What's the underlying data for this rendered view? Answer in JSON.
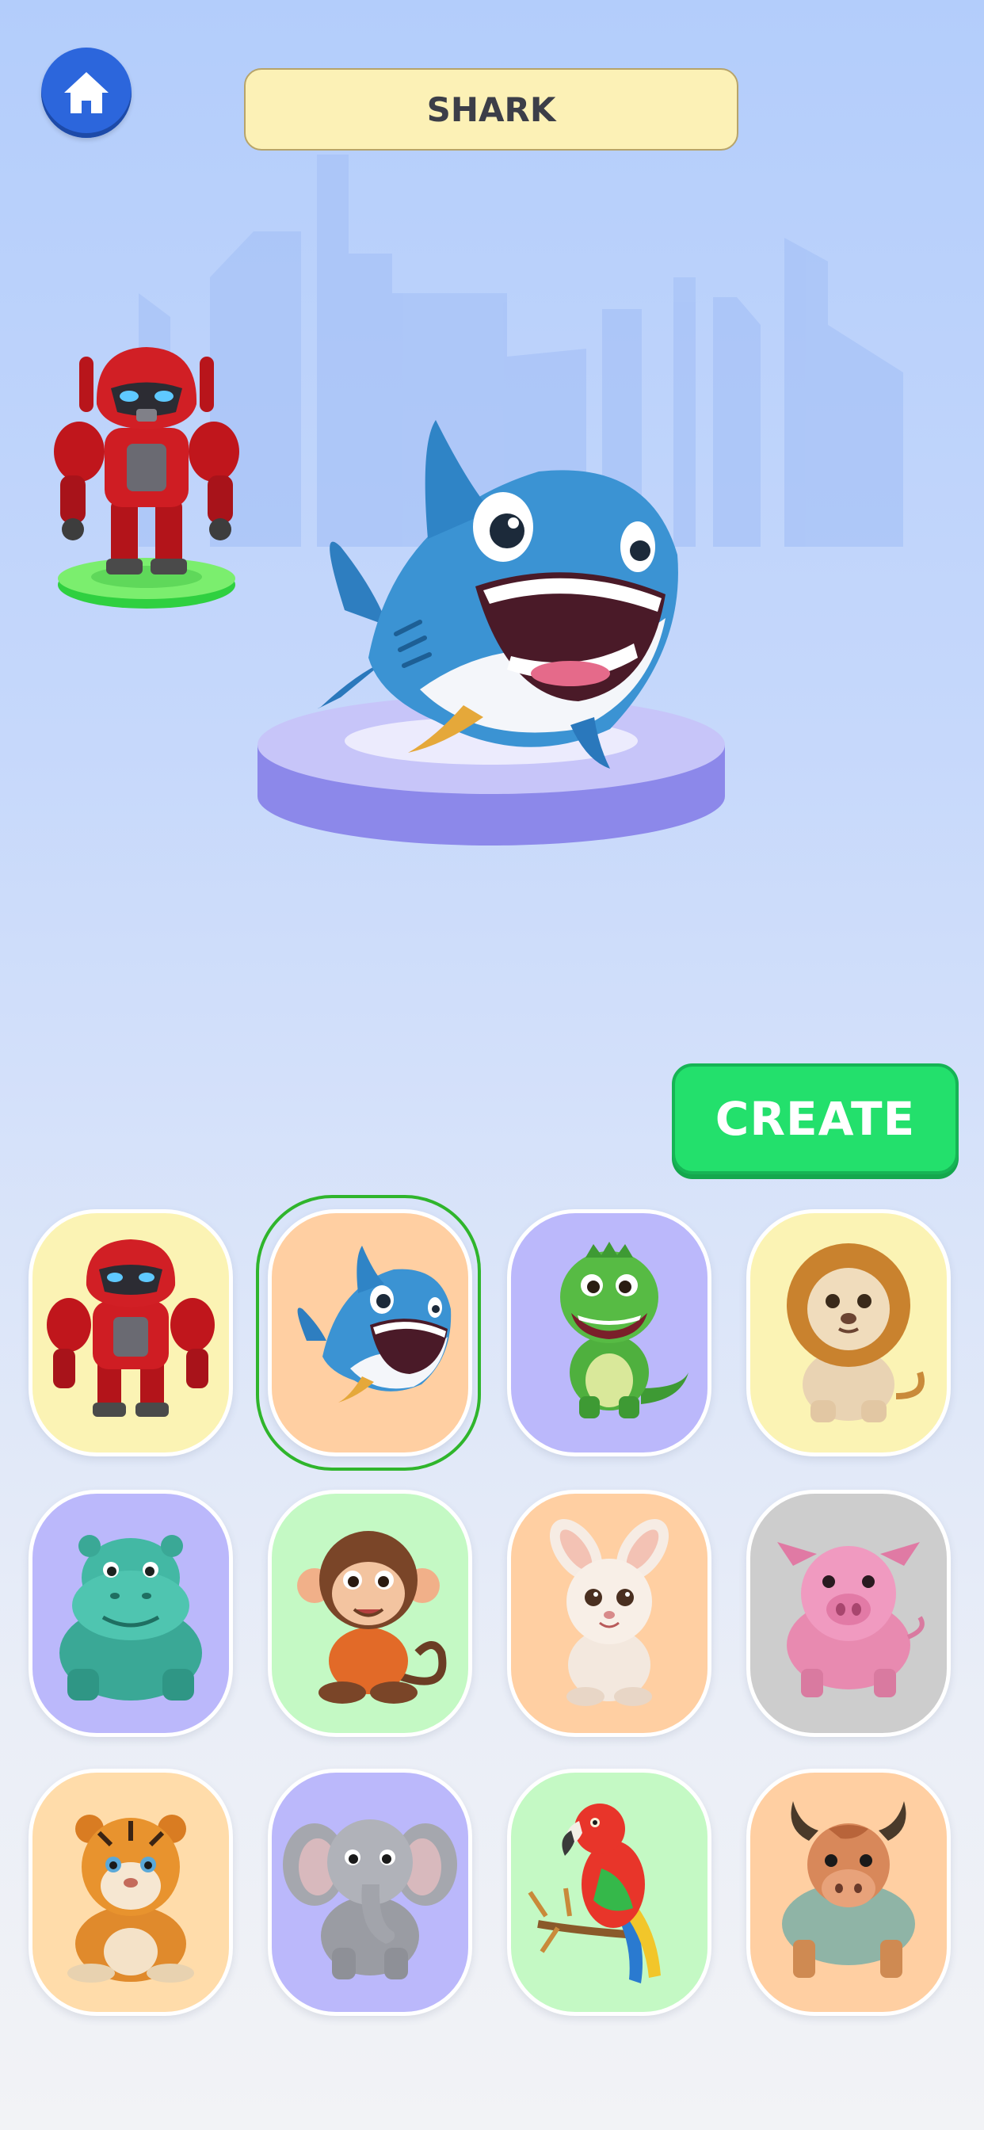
{
  "header": {
    "title": "SHARK",
    "home_icon": "home-icon"
  },
  "actions": {
    "create_label": "CREATE"
  },
  "selected_character": "shark",
  "preview_character": "robot",
  "colors": {
    "yellow": "#fbf3b4",
    "peach": "#ffcfa2",
    "lavender": "#bbb8fb",
    "mint": "#c4f9c4",
    "gray": "#cdcdcd",
    "light_peach": "#ffdcaa",
    "create_green": "#23e06c",
    "home_blue": "#2c66dc",
    "selection_green": "#2fb52c"
  },
  "grid": [
    {
      "name": "robot",
      "bg": "#fbf3b4"
    },
    {
      "name": "shark",
      "bg": "#ffcfa2",
      "selected": true
    },
    {
      "name": "dinosaur",
      "bg": "#bbb8fb"
    },
    {
      "name": "lion",
      "bg": "#fbf3b4"
    },
    {
      "name": "hippo",
      "bg": "#bbb8fb"
    },
    {
      "name": "monkey",
      "bg": "#c4f9c4"
    },
    {
      "name": "bunny",
      "bg": "#ffcfa2"
    },
    {
      "name": "pig",
      "bg": "#cdcdcd"
    },
    {
      "name": "tiger",
      "bg": "#ffdcaa"
    },
    {
      "name": "elephant",
      "bg": "#bbb8fb"
    },
    {
      "name": "parrot",
      "bg": "#c4f9c4"
    },
    {
      "name": "bull",
      "bg": "#ffcfa2"
    }
  ]
}
